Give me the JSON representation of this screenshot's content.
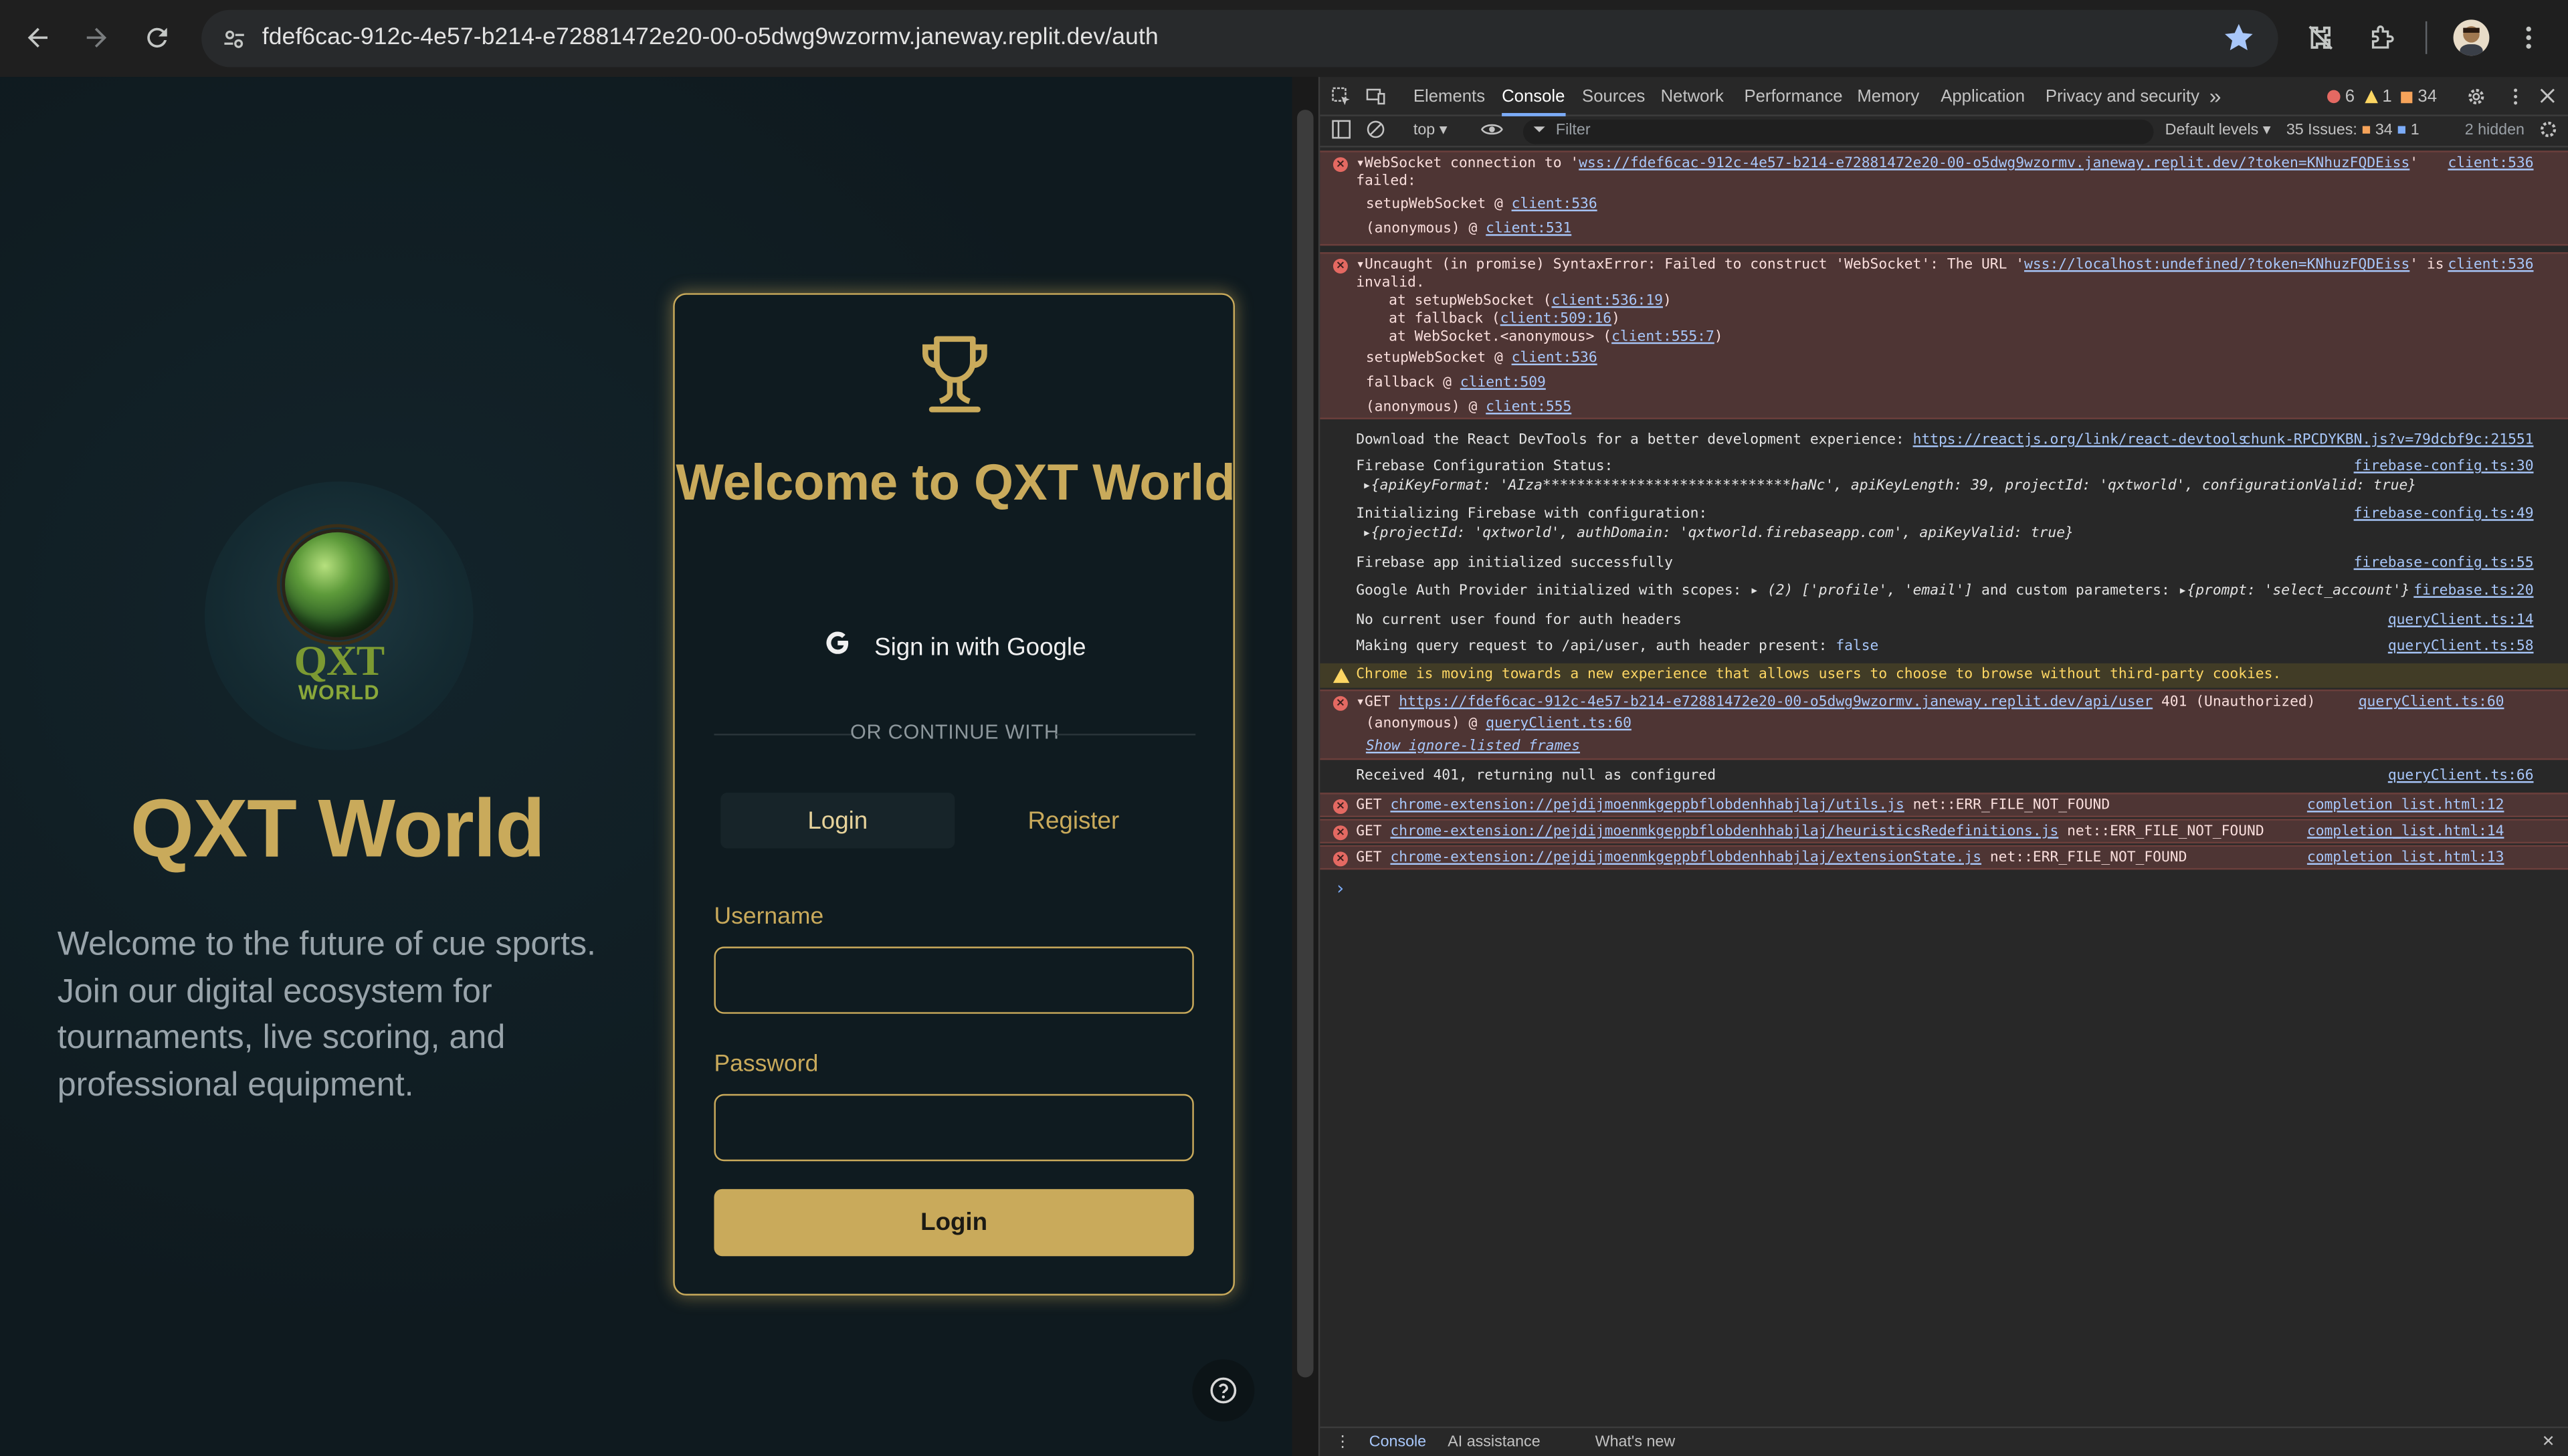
{
  "browser": {
    "url": "fdef6cac-912c-4e57-b214-e72881472e20-00-o5dwg9wzormv.janeway.replit.dev/auth",
    "accent": "#a8c7fa"
  },
  "app": {
    "logo_word": "QXT",
    "logo_sub": "WORLD",
    "hero_title": "QXT World",
    "hero_desc": "Welcome to the future of cue sports. Join our digital ecosystem for tournaments, live scoring, and professional equipment.",
    "card_title": "Welcome to QXT World",
    "google_label": "Sign in with Google",
    "or_text": "OR CONTINUE WITH",
    "tab_login": "Login",
    "tab_register": "Register",
    "username_label": "Username",
    "password_label": "Password",
    "username_value": "",
    "password_value": "",
    "submit_label": "Login",
    "brand_color": "#c9aa5b"
  },
  "devtools": {
    "tabs": [
      "Elements",
      "Console",
      "Sources",
      "Network",
      "Performance",
      "Memory",
      "Application",
      "Privacy and security"
    ],
    "more_tabs": "»",
    "error_count": "6",
    "warning_count": "1",
    "issue_count_top": "34",
    "context": "top",
    "filter_placeholder": "Filter",
    "levels": "Default levels",
    "issues_label": "35 Issues:",
    "issues_errors": "34",
    "issues_info": "1",
    "hidden": "2 hidden",
    "drawer_console": "Console",
    "drawer_ai": "AI assistance",
    "drawer_whatsnew": "What's new",
    "messages": {
      "ws_fail_1": "WebSocket connection to '",
      "ws_fail_url": "wss://fdef6cac-912c-4e57-b214-e72881472e20-00-o5dwg9wzormv.janeway.replit.dev/?token=KNhuzFQDEiss",
      "ws_fail_2": "'",
      "ws_fail_3": "failed:",
      "ws_stack_1": "setupWebSocket @",
      "ws_stack_1_src": "client:536",
      "ws_stack_2": "(anonymous)    @",
      "ws_stack_2_src": "client:531",
      "ws_src": "client:536",
      "syntax_1": "Uncaught (in promise) SyntaxError: Failed to construct 'WebSocket': The URL '",
      "syntax_url": "wss://localhost:undefined/?token=KNhuzFQDEiss",
      "syntax_2": "' is",
      "syntax_3": "invalid.",
      "syntax_at1": "at setupWebSocket (",
      "syntax_at1_src": "client:536:19",
      "syntax_at2": "at fallback (",
      "syntax_at2_src": "client:509:16",
      "syntax_at3": "at WebSocket.<anonymous> (",
      "syntax_at3_src": "client:555:7",
      "syntax_s1": "setupWebSocket @",
      "syntax_s1_src": "client:536",
      "syntax_s2": "fallback       @",
      "syntax_s2_src": "client:509",
      "syntax_s3": "(anonymous)    @",
      "syntax_s3_src": "client:555",
      "syntax_src": "client:536",
      "react_1": "Download the React DevTools for a better development experience:",
      "react_url": "https://reactjs.org/link/react-devtools",
      "react_src": "chunk-RPCDYKBN.js?v=79dcbf9c:21551",
      "fb_status": "Firebase Configuration Status:",
      "fb_status_obj": "{apiKeyFormat: 'AIza*****************************haNc', apiKeyLength: 39, projectId: 'qxtworld', configurationValid: true}",
      "fb_status_src": "firebase-config.ts:30",
      "fb_init": "Initializing Firebase with configuration:",
      "fb_init_obj": "{projectId: 'qxtworld', authDomain: 'qxtworld.firebaseapp.com', apiKeyValid: true}",
      "fb_init_src": "firebase-config.ts:49",
      "fb_ok": "Firebase app initialized successfully",
      "fb_ok_src": "firebase-config.ts:55",
      "gauth": "Google Auth Provider initialized with scopes:",
      "gauth_obj": "(2) ['profile', 'email']",
      "gauth_mid": "and custom parameters:",
      "gauth_obj2": "{prompt: 'select_account'}",
      "gauth_src": "firebase.ts:20",
      "nouser": "No current user found for auth headers",
      "nouser_src": "queryClient.ts:14",
      "query": "Making query request to /api/user, auth header present:",
      "query_val": "false",
      "query_src": "queryClient.ts:58",
      "cookies": "Chrome is moving towards a new experience that allows users to choose to browse without third-party cookies.",
      "get401_1": "GET",
      "get401_url": "https://fdef6cac-912c-4e57-b214-e72881472e20-00-o5dwg9wzormv.janeway.replit.dev/api/user",
      "get401_2": "401 (Unauthorized)",
      "get401_anon": "(anonymous) @",
      "get401_anon_src": "queryClient.ts:60",
      "get401_show": "Show ignore-listed frames",
      "get401_src": "queryClient.ts:60",
      "recv401": "Received 401, returning null as configured",
      "recv401_src": "queryClient.ts:66",
      "ext1_url": "chrome-extension://pejdijmoenmkgeppbflobdenhhabjlaj/utils.js",
      "ext1_err": "net::ERR_FILE_NOT_FOUND",
      "ext1_src": "completion_list.html:12",
      "ext2_url": "chrome-extension://pejdijmoenmkgeppbflobdenhhabjlaj/heuristicsRedefinitions.js",
      "ext2_err": "net::ERR_FILE_NOT_FOUND",
      "ext2_src": "completion_list.html:14",
      "ext3_url": "chrome-extension://pejdijmoenmkgeppbflobdenhhabjlaj/extensionState.js",
      "ext3_err": "net::ERR_FILE_NOT_FOUND",
      "ext3_src": "completion_list.html:13",
      "get": "GET",
      "prompt": "›"
    }
  }
}
